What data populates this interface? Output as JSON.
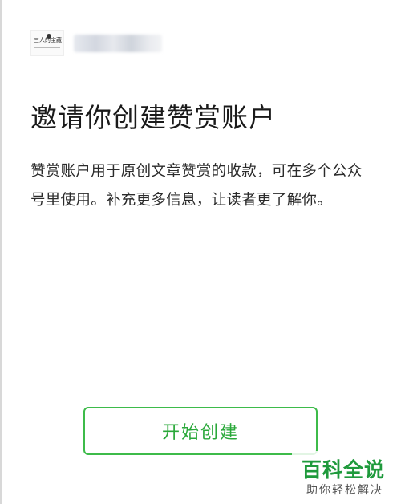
{
  "account": {
    "avatar_text": "三人的宝藏"
  },
  "page": {
    "title": "邀请你创建赞赏账户",
    "description": "赞赏账户用于原创文章赞赏的收款，可在多个公众号里使用。补充更多信息，让读者更了解你。"
  },
  "actions": {
    "start_label": "开始创建"
  },
  "watermark": {
    "main": "百科全说",
    "sub": "助你轻松解决"
  },
  "colors": {
    "accent_green": "#2aa83a",
    "watermark_green": "#1f9a3c"
  }
}
